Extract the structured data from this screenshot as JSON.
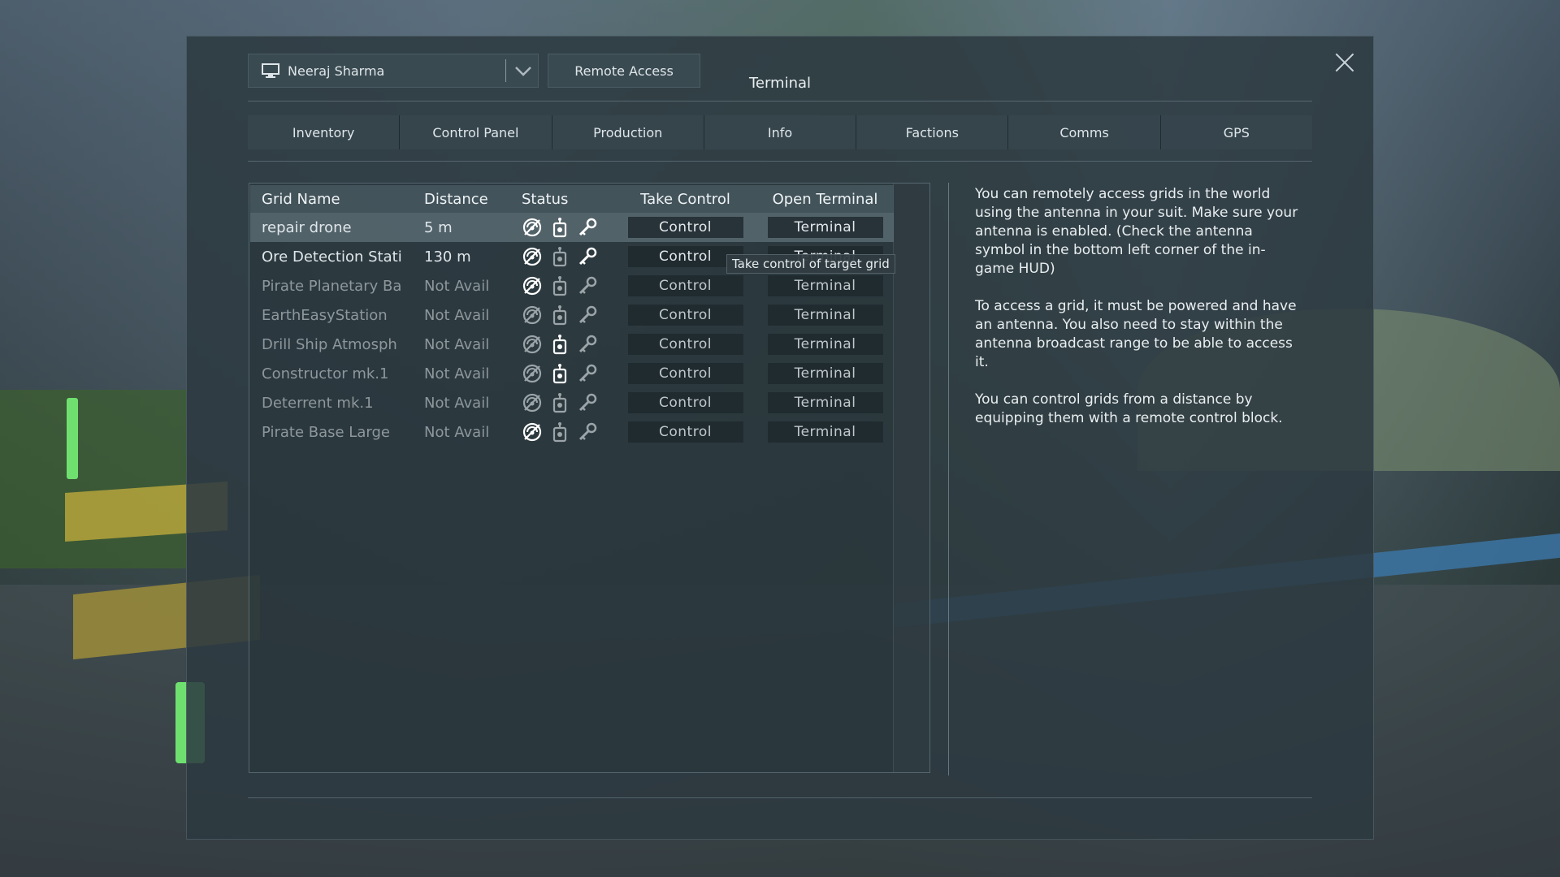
{
  "header": {
    "player_name": "Neeraj Sharma",
    "remote_access_label": "Remote Access",
    "title": "Terminal"
  },
  "tabs": [
    {
      "label": "Inventory"
    },
    {
      "label": "Control Panel"
    },
    {
      "label": "Production"
    },
    {
      "label": "Info"
    },
    {
      "label": "Factions"
    },
    {
      "label": "Comms"
    },
    {
      "label": "GPS"
    }
  ],
  "table": {
    "headers": {
      "name": "Grid Name",
      "distance": "Distance",
      "status": "Status",
      "take_control": "Take Control",
      "open_terminal": "Open Terminal"
    },
    "rows": [
      {
        "name": "repair drone",
        "distance": "5 m",
        "control": "Control",
        "terminal": "Terminal"
      },
      {
        "name": "Ore Detection Stati",
        "distance": "130 m",
        "control": "Control",
        "terminal": "Terminal"
      },
      {
        "name": "Pirate Planetary Ba",
        "distance": "Not Avail",
        "control": "Control",
        "terminal": "Terminal"
      },
      {
        "name": "EarthEasyStation",
        "distance": "Not Avail",
        "control": "Control",
        "terminal": "Terminal"
      },
      {
        "name": "Drill Ship Atmosph",
        "distance": "Not Avail",
        "control": "Control",
        "terminal": "Terminal"
      },
      {
        "name": "Constructor mk.1",
        "distance": "Not Avail",
        "control": "Control",
        "terminal": "Terminal"
      },
      {
        "name": "Deterrent mk.1",
        "distance": "Not Avail",
        "control": "Control",
        "terminal": "Terminal"
      },
      {
        "name": "Pirate Base Large",
        "distance": "Not Avail",
        "control": "Control",
        "terminal": "Terminal"
      }
    ]
  },
  "tooltip": "Take control of target grid",
  "help": {
    "p1": "You can remotely access grids in the world using the antenna in your suit. Make sure your antenna is enabled. (Check the antenna symbol in the bottom left corner of the in-game HUD)",
    "p2": "To access a grid, it must be powered and have an antenna. You also need to stay within the antenna broadcast range to be able to access it.",
    "p3": "You can control grids from a distance by equipping them with a remote control block."
  },
  "icons": {
    "antenna": "antenna-signal-icon",
    "control": "remote-control-icon",
    "access": "key-icon"
  }
}
